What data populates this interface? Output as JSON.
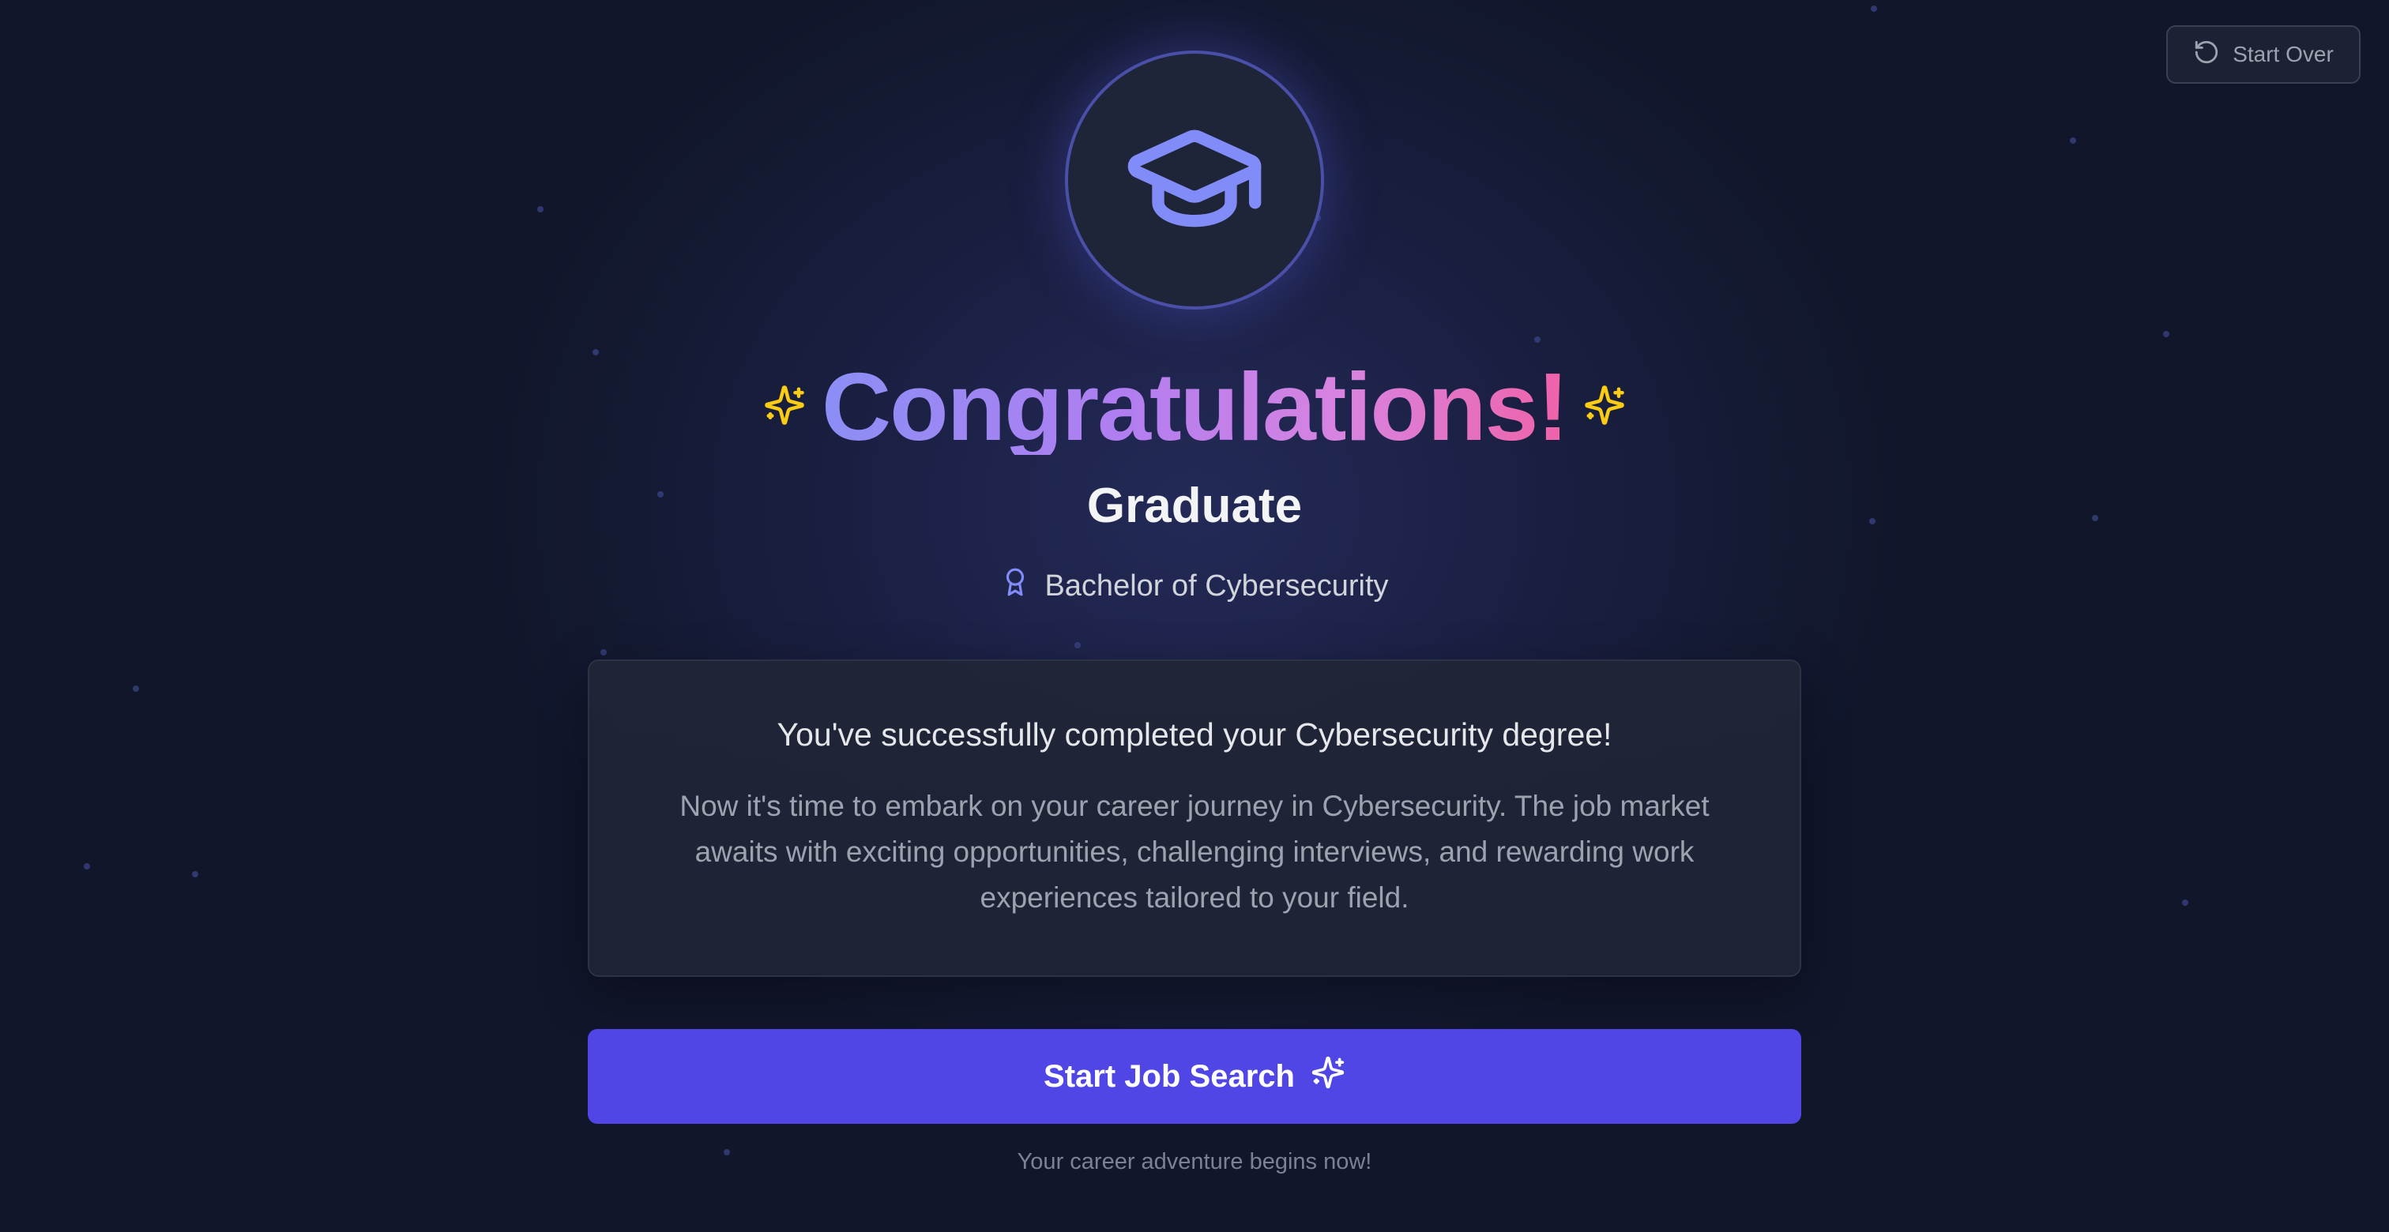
{
  "header": {
    "restart_label": "Start Over",
    "restart_icon": "rotate-ccw-icon"
  },
  "hero": {
    "icon": "graduation-cap-icon",
    "title": "Congratulations!",
    "title_icon": "sparkles-icon",
    "subtitle": "Graduate",
    "degree_icon": "award-icon",
    "degree": "Bachelor of Cybersecurity"
  },
  "card": {
    "heading": "You've successfully completed your Cybersecurity degree!",
    "body": "Now it's time to embark on your career journey in Cybersecurity. The job market awaits with exciting opportunities, challenging interviews, and rewarding work experiences tailored to your field."
  },
  "cta": {
    "label": "Start Job Search",
    "icon": "sparkles-icon"
  },
  "footer": {
    "note": "Your career adventure begins now!"
  },
  "colors": {
    "background": "#141a33",
    "accent": "#4f46e5",
    "icon_accent": "#818cf8",
    "sparkle": "#facc15",
    "gradient_start": "#8b8ff5",
    "gradient_end": "#f062a8"
  }
}
